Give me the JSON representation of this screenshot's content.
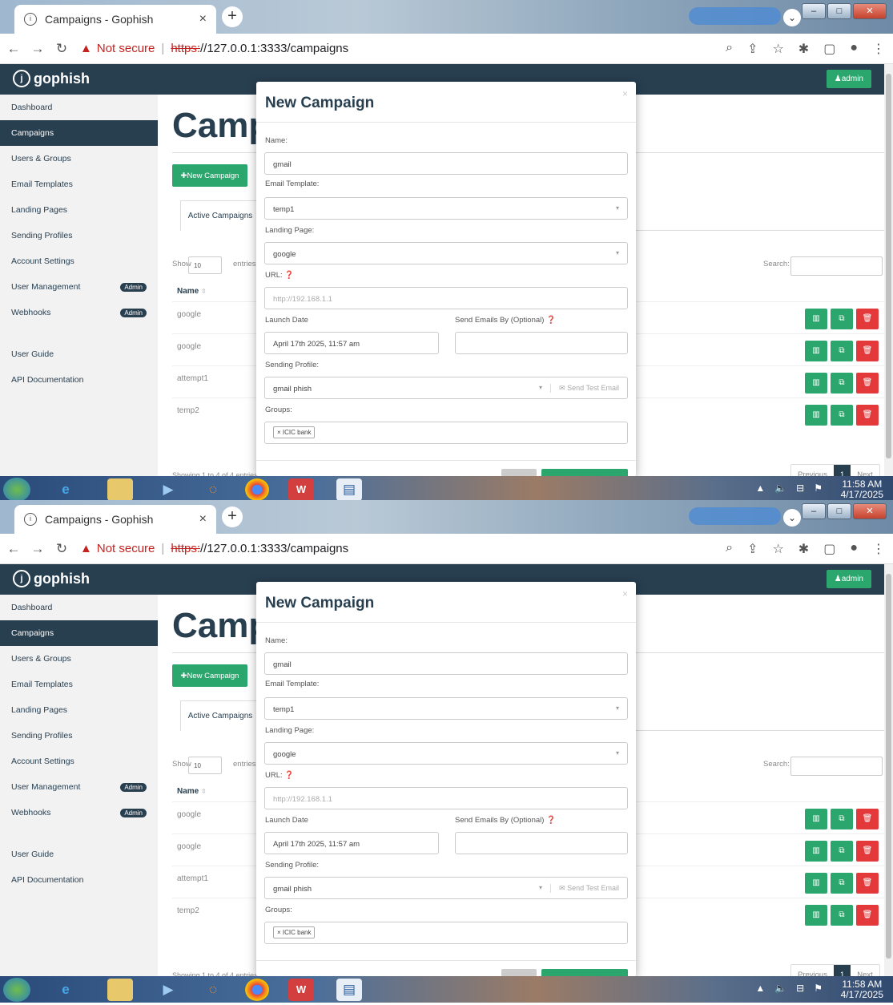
{
  "browser": {
    "tab_title": "Campaigns - Gophish",
    "tab_close": "×",
    "new_tab": "+",
    "not_secure": "Not secure",
    "url_scheme": "https:",
    "url_rest": "//127.0.0.1:3333/campaigns"
  },
  "app": {
    "brand": "gophish",
    "admin_label": "admin",
    "page_title": "Camp",
    "sidebar": [
      {
        "label": "Dashboard",
        "active": false,
        "badge": ""
      },
      {
        "label": "Campaigns",
        "active": true,
        "badge": ""
      },
      {
        "label": "Users & Groups",
        "active": false,
        "badge": ""
      },
      {
        "label": "Email Templates",
        "active": false,
        "badge": ""
      },
      {
        "label": "Landing Pages",
        "active": false,
        "badge": ""
      },
      {
        "label": "Sending Profiles",
        "active": false,
        "badge": ""
      },
      {
        "label": "Account Settings",
        "active": false,
        "badge": ""
      },
      {
        "label": "User Management",
        "active": false,
        "badge": "Admin"
      },
      {
        "label": "Webhooks",
        "active": false,
        "badge": "Admin"
      }
    ],
    "sidebar_bottom": [
      "User Guide",
      "API Documentation"
    ],
    "new_campaign_btn": "New Campaign",
    "active_tab": "Active Campaigns",
    "show_label": "Show",
    "show_value": "10",
    "entries_label": "entries",
    "search_label": "Search:",
    "name_header": "Name",
    "rows": [
      "google",
      "google",
      "attempt1",
      "temp2"
    ],
    "showing_text": "Showing 1 to 4 of 4 entries",
    "pager": {
      "prev": "Previous",
      "page": "1",
      "next": "Next"
    }
  },
  "modal": {
    "title": "New Campaign",
    "close": "×",
    "name_label": "Name:",
    "name_value": "gmail",
    "template_label": "Email Template:",
    "template_value": "temp1",
    "landing_label": "Landing Page:",
    "landing_value": "google",
    "url_label": "URL:",
    "url_placeholder": "http://192.168.1.1",
    "launch_label": "Launch Date",
    "launch_value": "April 17th 2025, 11:57 am",
    "sendby_label": "Send Emails By (Optional)",
    "profile_label": "Sending Profile:",
    "profile_value": "gmail phish",
    "send_test": "Send Test Email",
    "groups_label": "Groups:",
    "group_chip": "× ICIC bank"
  },
  "taskbar": {
    "time": "11:58 AM",
    "date": "4/17/2025"
  },
  "colors": {
    "navy": "#283f50",
    "green": "#2ba76e",
    "red": "#e3393a"
  }
}
